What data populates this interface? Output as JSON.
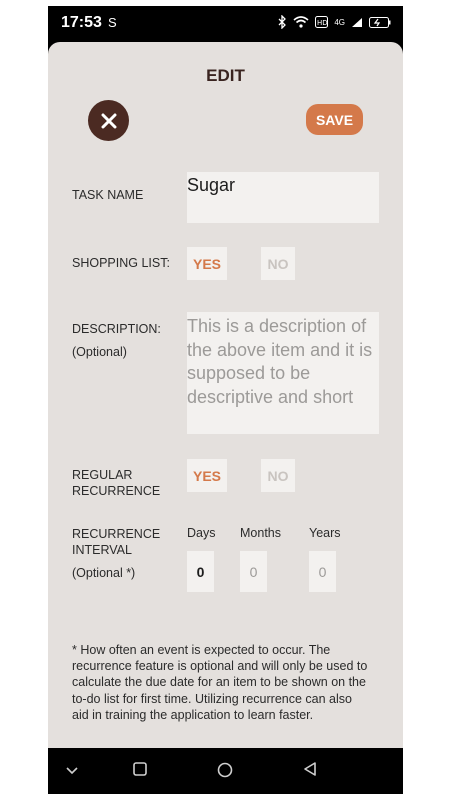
{
  "status_bar": {
    "time": "17:53",
    "carrier_icon": "S",
    "network": "4G"
  },
  "header": {
    "title": "EDIT",
    "save_label": "SAVE",
    "close_icon": "close-icon"
  },
  "form": {
    "task_name_label": "TASK NAME",
    "task_name_value": "Sugar",
    "shopping_list_label": "SHOPPING LIST:",
    "shopping_yes": "YES",
    "shopping_no": "NO",
    "description_label": "DESCRIPTION:",
    "description_optional": "(Optional)",
    "description_placeholder": "This is a description of the above item and it is supposed to be descriptive and short",
    "recurrence_label_1": "REGULAR",
    "recurrence_label_2": "RECURRENCE",
    "recurrence_yes": "YES",
    "recurrence_no": "NO",
    "interval_label_1": "RECURRENCE",
    "interval_label_2": "INTERVAL",
    "interval_optional": "(Optional *)",
    "units": [
      "Days",
      "Months",
      "Years"
    ],
    "values": [
      "0",
      "0",
      "0"
    ],
    "footnote": "* How often an event is expected to occur. The recurrence feature is optional and will only be used to calculate the due date for an item to be shown on the to-do list for first time. Utilizing recurrence can also aid in training the application to learn faster."
  },
  "colors": {
    "accent": "#d4794a",
    "close_bg": "#4b2a22",
    "background": "#e4e0dd",
    "field": "#f3f1ef"
  }
}
